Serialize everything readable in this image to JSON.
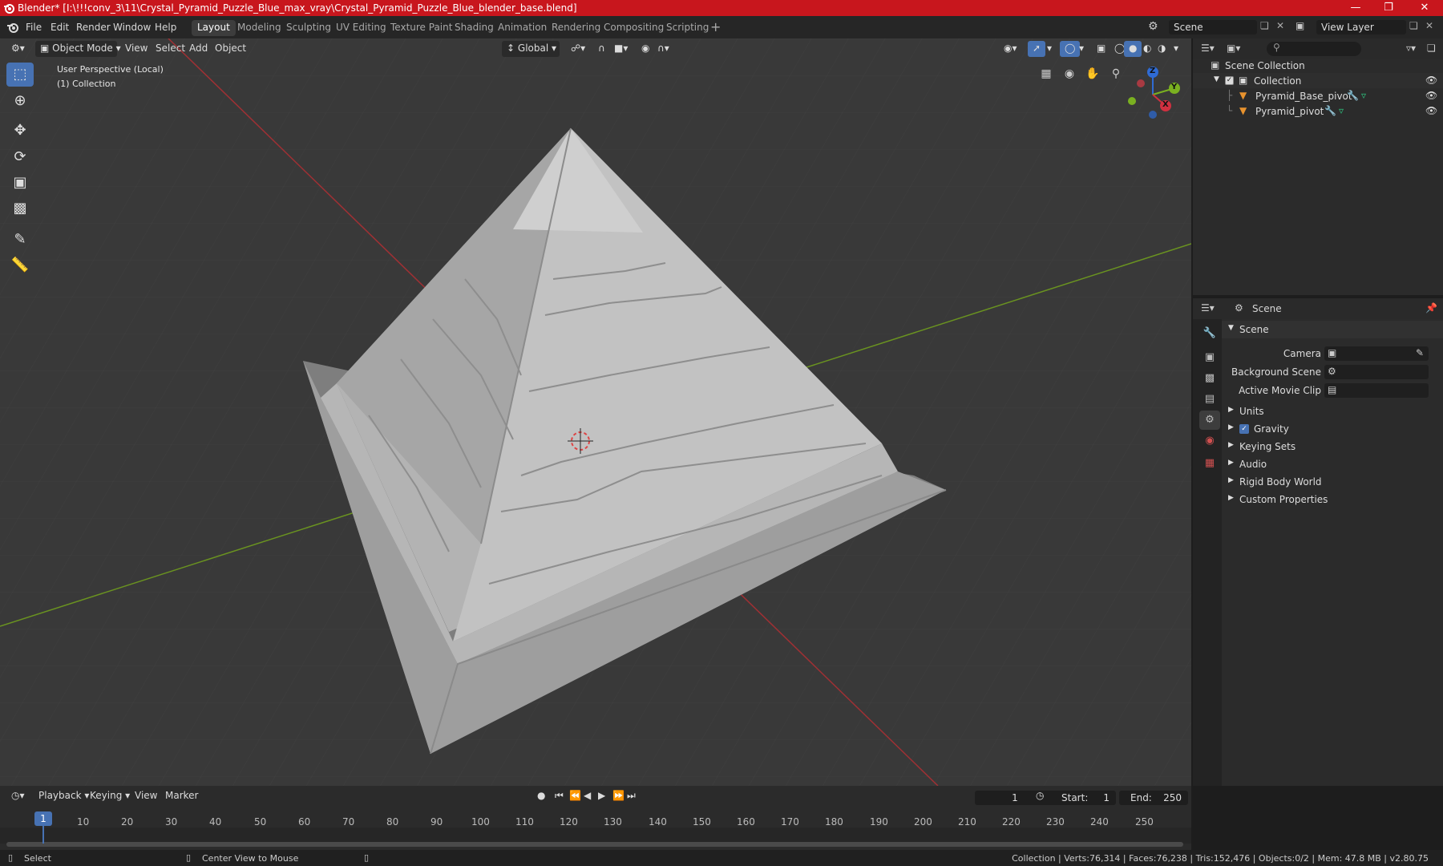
{
  "app": {
    "title": "Blender* [I:\\!!!conv_3\\11\\Crystal_Pyramid_Puzzle_Blue_max_vray\\Crystal_Pyramid_Puzzle_Blue_blender_base.blend]"
  },
  "menu": [
    "File",
    "Edit",
    "Render",
    "Window",
    "Help"
  ],
  "workspaces": [
    "Layout",
    "Modeling",
    "Sculpting",
    "UV Editing",
    "Texture Paint",
    "Shading",
    "Animation",
    "Rendering",
    "Compositing",
    "Scripting"
  ],
  "scene_field": "Scene",
  "view_layer_field": "View Layer",
  "viewport": {
    "mode": "Object Mode",
    "menus": [
      "View",
      "Select",
      "Add",
      "Object"
    ],
    "orientation": "Global",
    "overlay_line1": "User Perspective (Local)",
    "overlay_line2": "(1) Collection",
    "gizmo": {
      "z": "Z",
      "y": "Y",
      "x": "X"
    }
  },
  "outliner": {
    "root": "Scene Collection",
    "collection": "Collection",
    "objects": [
      "Pyramid_Base_pivot",
      "Pyramid_pivot"
    ]
  },
  "properties": {
    "header": "Scene",
    "panel": "Scene",
    "camera_label": "Camera",
    "bg_scene_label": "Background Scene",
    "movie_clip_label": "Active Movie Clip",
    "sections": [
      "Units",
      "Gravity",
      "Keying Sets",
      "Audio",
      "Rigid Body World",
      "Custom Properties"
    ]
  },
  "timeline": {
    "menus": [
      "Playback",
      "Keying",
      "View",
      "Marker"
    ],
    "current_frame": "1",
    "start_label": "Start:",
    "start": "1",
    "end_label": "End:",
    "end": "250",
    "ticks": [
      "1",
      "10",
      "20",
      "30",
      "40",
      "50",
      "60",
      "70",
      "80",
      "90",
      "100",
      "110",
      "120",
      "130",
      "140",
      "150",
      "160",
      "170",
      "180",
      "190",
      "200",
      "210",
      "220",
      "230",
      "240",
      "250"
    ]
  },
  "status": {
    "left1": "Select",
    "left2": "Center View to Mouse",
    "right": "Collection | Verts:76,314 | Faces:76,238 | Tris:152,476 | Objects:0/2 | Mem: 47.8 MB | v2.80.75"
  },
  "colors": {
    "title_bg": "#c8161d",
    "accent": "#4772b3",
    "x_axis": "#b03236",
    "y_axis": "#6e9a23"
  }
}
